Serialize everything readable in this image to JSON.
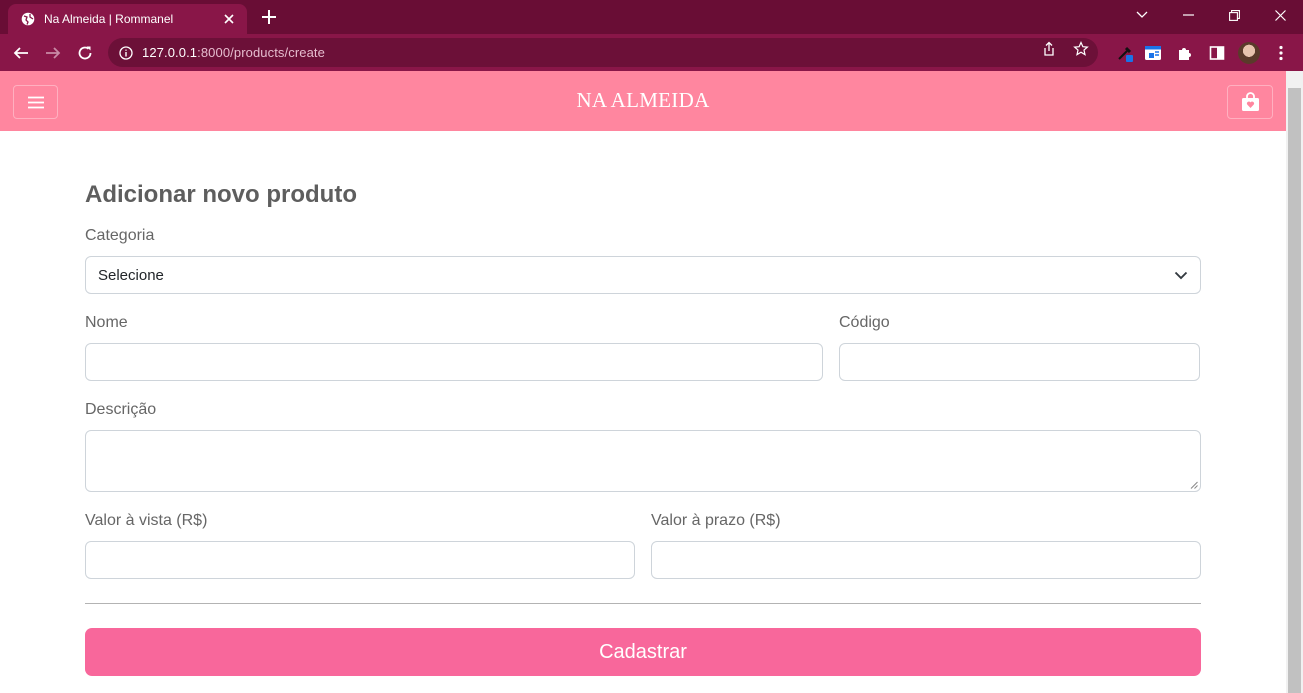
{
  "browser": {
    "tab_title": "Na Almeida | Rommanel",
    "url_host": "127.0.0.1",
    "url_path": ":8000/products/create",
    "colors": {
      "tabbar": "#690d35",
      "toolbar": "#891648"
    }
  },
  "header": {
    "brand": "NA ALMEIDA",
    "menu_icon": "hamburger-icon",
    "cart_icon": "shopping-bag-icon",
    "background": "#ff869f"
  },
  "form": {
    "title": "Adicionar novo produto",
    "category": {
      "label": "Categoria",
      "selected": "Selecione"
    },
    "name": {
      "label": "Nome",
      "value": ""
    },
    "code": {
      "label": "Código",
      "value": ""
    },
    "description": {
      "label": "Descrição",
      "value": ""
    },
    "cash_price": {
      "label": "Valor à vista (R$)",
      "value": ""
    },
    "term_price": {
      "label": "Valor à prazo (R$)",
      "value": ""
    },
    "submit_label": "Cadastrar",
    "accent": "#f8679b"
  }
}
